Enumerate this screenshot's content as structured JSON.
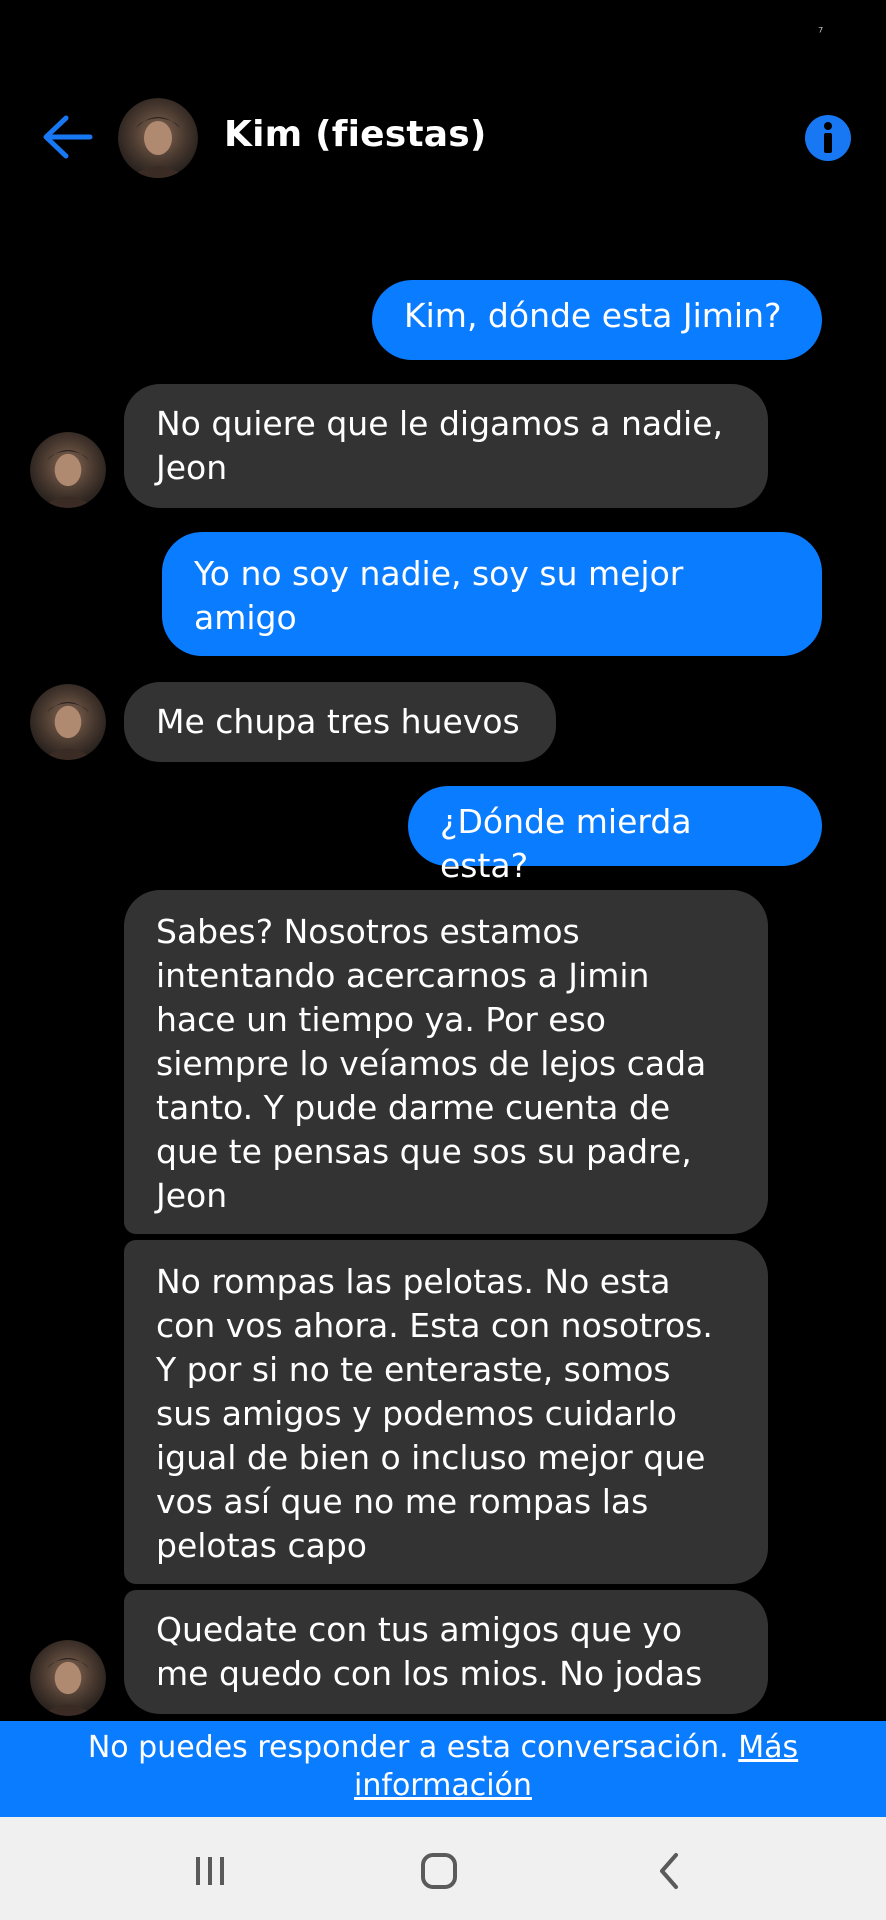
{
  "status": {
    "glyph": "⁷"
  },
  "header": {
    "title": "Kim (fiestas)",
    "back_icon": "arrow-left-icon",
    "info_icon": "info-icon",
    "accent_color": "#0a7cff"
  },
  "messages": [
    {
      "from": "me",
      "text": "Kim, dónde esta Jimin?"
    },
    {
      "from": "them",
      "text": "No quiere que le digamos a nadie, Jeon"
    },
    {
      "from": "me",
      "text": "Yo no soy nadie, soy su mejor amigo"
    },
    {
      "from": "them",
      "text": "Me chupa tres huevos"
    },
    {
      "from": "me",
      "text": "¿Dónde mierda esta?"
    },
    {
      "from": "them",
      "text": "Sabes? Nosotros estamos intentando acercarnos a Jimin hace un tiempo ya. Por eso siempre lo veíamos de lejos cada tanto. Y pude darme cuenta de que te pensas que sos su padre, Jeon"
    },
    {
      "from": "them",
      "text": "No rompas las pelotas. No esta con vos ahora. Esta con nosotros. Y por si no te enteraste, somos sus amigos y podemos cuidarlo igual de bien o incluso mejor que vos así que no me rompas las pelotas capo"
    },
    {
      "from": "them",
      "text": "Quedate con tus amigos que yo me quedo con los mios. No jodas"
    }
  ],
  "banner": {
    "text": "No puedes responder a esta conversación.",
    "link": "Más información"
  },
  "navbar": {
    "recents_icon": "recents-icon",
    "home_icon": "home-icon",
    "back_icon": "back-chevron-icon"
  },
  "colors": {
    "sent_bubble": "#0a7cff",
    "received_bubble": "#333333",
    "background": "#000000"
  }
}
